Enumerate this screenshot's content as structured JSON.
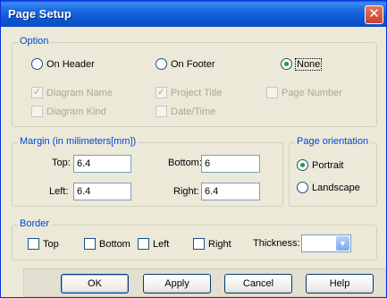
{
  "window": {
    "title": "Page Setup"
  },
  "option": {
    "legend": "Option",
    "radios": [
      {
        "label": "On Header",
        "selected": false
      },
      {
        "label": "On Footer",
        "selected": false
      },
      {
        "label": "None",
        "selected": true
      }
    ],
    "checks": [
      {
        "label": "Diagram Name",
        "checked": true,
        "enabled": false
      },
      {
        "label": "Project Title",
        "checked": true,
        "enabled": false
      },
      {
        "label": "Page Number",
        "checked": false,
        "enabled": false
      },
      {
        "label": "Diagram Kind",
        "checked": false,
        "enabled": false
      },
      {
        "label": "Date/Time",
        "checked": false,
        "enabled": false
      }
    ]
  },
  "margin": {
    "legend": "Margin (in milimeters[mm])",
    "top_label": "Top:",
    "top_value": "6.4",
    "bottom_label": "Bottom:",
    "bottom_value": "6",
    "left_label": "Left:",
    "left_value": "6.4",
    "right_label": "Right:",
    "right_value": "6.4"
  },
  "orientation": {
    "legend": "Page orientation",
    "portrait": "Portrait",
    "landscape": "Landscape",
    "selected": "Portrait"
  },
  "border": {
    "legend": "Border",
    "top": "Top",
    "bottom": "Bottom",
    "left": "Left",
    "right": "Right",
    "thickness_label": "Thickness:",
    "thickness_value": ""
  },
  "buttons": {
    "ok": "OK",
    "apply": "Apply",
    "cancel": "Cancel",
    "help": "Help"
  },
  "colors": {
    "title_bar": "#0a56d0",
    "group_label": "#0046d5",
    "check_mark": "#21a121",
    "dialog_bg": "#ece9d8"
  }
}
